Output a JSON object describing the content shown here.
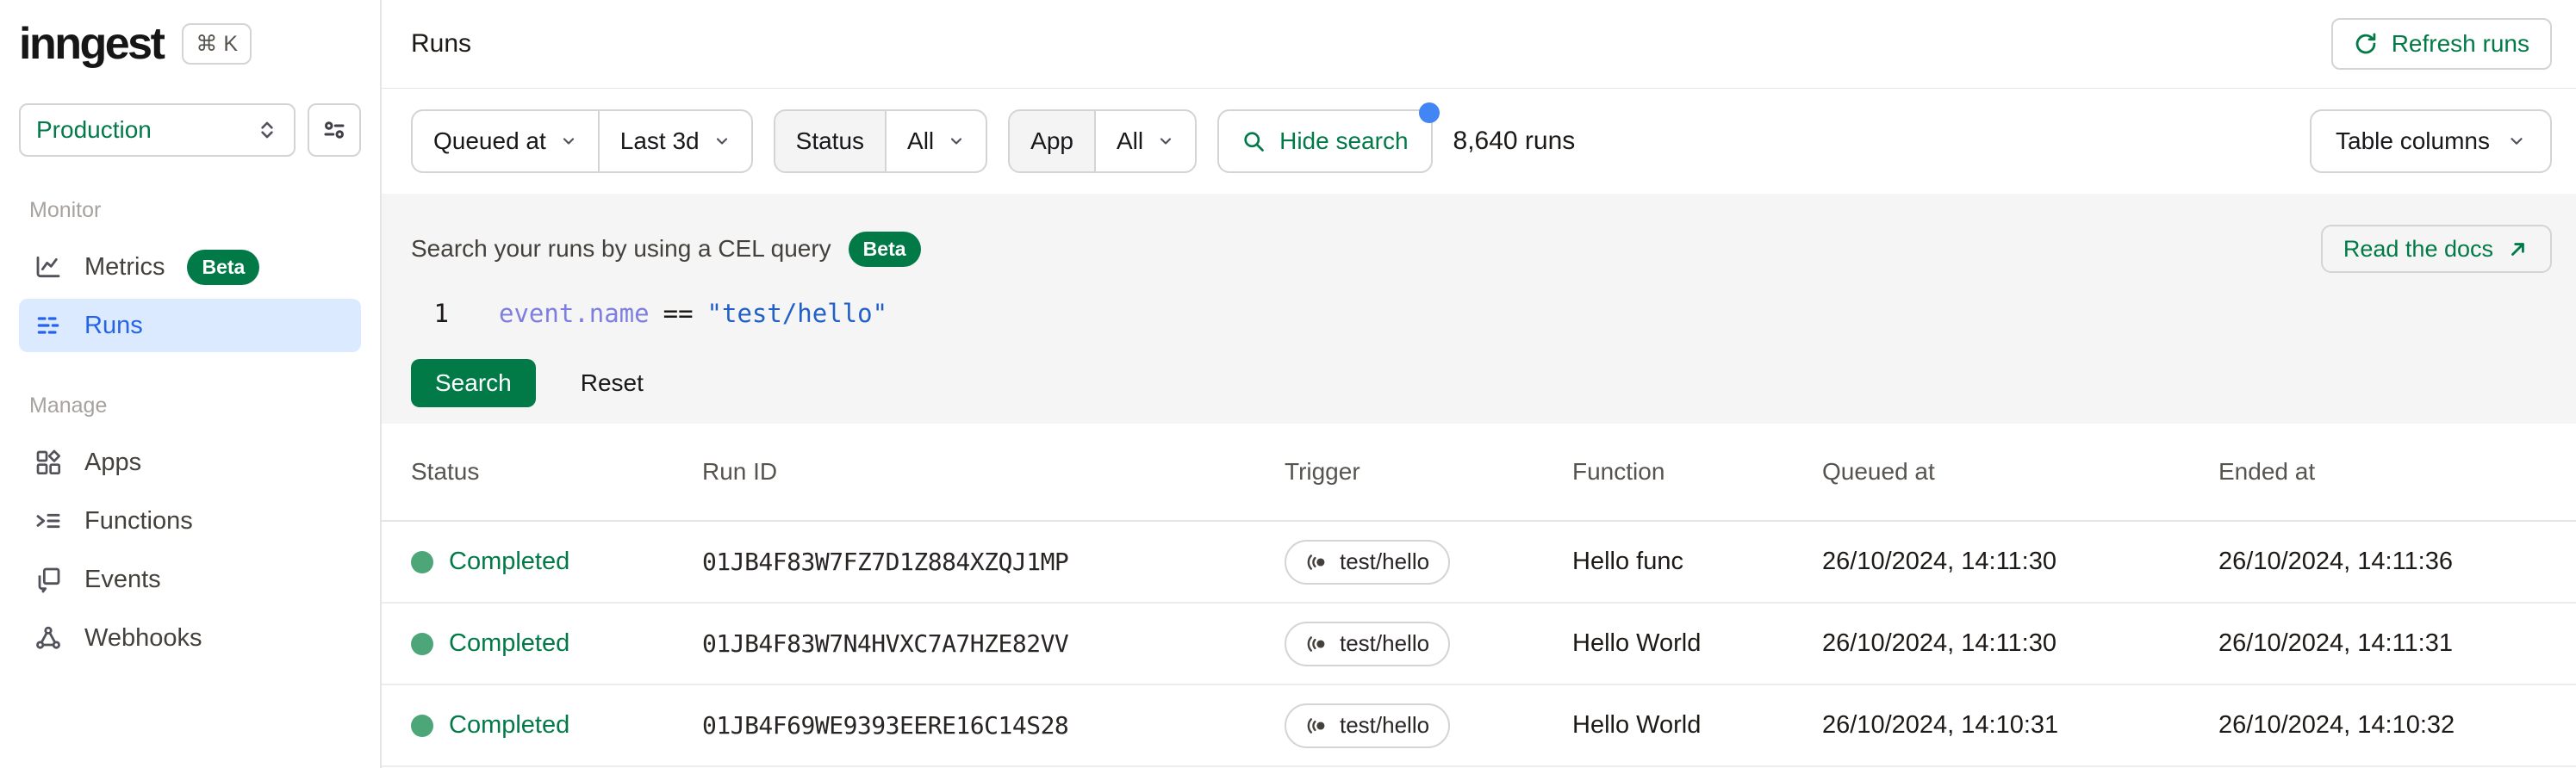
{
  "colors": {
    "accent_green": "#027A48",
    "status_dot_green": "#4CA678",
    "active_item_blue": "#2563EB",
    "active_item_bg": "#DBEAFE",
    "notification_dot_blue": "#4285F4",
    "code_property_purple": "#7E7EE0",
    "code_string_blue": "#2160C7",
    "panel_gray": "#F5F5F5"
  },
  "brand": {
    "logo": "inngest",
    "shortcut": "⌘ K"
  },
  "sidebar": {
    "env_selector": {
      "value": "Production"
    },
    "sections": [
      {
        "label": "Monitor",
        "items": [
          {
            "label": "Metrics",
            "badge": "Beta",
            "icon": "metrics-icon"
          },
          {
            "label": "Runs",
            "icon": "runs-icon"
          }
        ]
      },
      {
        "label": "Manage",
        "items": [
          {
            "label": "Apps",
            "icon": "apps-icon"
          },
          {
            "label": "Functions",
            "icon": "functions-icon"
          },
          {
            "label": "Events",
            "icon": "events-icon"
          },
          {
            "label": "Webhooks",
            "icon": "webhooks-icon"
          }
        ]
      }
    ]
  },
  "header": {
    "title": "Runs",
    "refresh_label": "Refresh runs"
  },
  "filters": {
    "time_field": "Queued at",
    "time_range": "Last 3d",
    "status_label": "Status",
    "status_value": "All",
    "app_label": "App",
    "app_value": "All",
    "search_toggle_label": "Hide search",
    "runs_count": "8,640 runs",
    "table_columns_label": "Table columns"
  },
  "search_panel": {
    "heading": "Search your runs by using a CEL query",
    "beta_badge": "Beta",
    "docs_link": "Read the docs",
    "editor": {
      "line_number": "1",
      "property_path": "event.name",
      "operator": "==",
      "string_value": "\"test/hello\""
    },
    "search_button": "Search",
    "reset_button": "Reset"
  },
  "table": {
    "columns": {
      "status": "Status",
      "run_id": "Run ID",
      "trigger": "Trigger",
      "function": "Function",
      "queued_at": "Queued at",
      "ended_at": "Ended at"
    },
    "rows": [
      {
        "status": "Completed",
        "run_id": "01JB4F83W7FZ7D1Z884XZQJ1MP",
        "trigger": "test/hello",
        "function": "Hello func",
        "queued_at": "26/10/2024, 14:11:30",
        "ended_at": "26/10/2024, 14:11:36"
      },
      {
        "status": "Completed",
        "run_id": "01JB4F83W7N4HVXC7A7HZE82VV",
        "trigger": "test/hello",
        "function": "Hello World",
        "queued_at": "26/10/2024, 14:11:30",
        "ended_at": "26/10/2024, 14:11:31"
      },
      {
        "status": "Completed",
        "run_id": "01JB4F69WE9393EERE16C14S28",
        "trigger": "test/hello",
        "function": "Hello World",
        "queued_at": "26/10/2024, 14:10:31",
        "ended_at": "26/10/2024, 14:10:32"
      }
    ]
  }
}
